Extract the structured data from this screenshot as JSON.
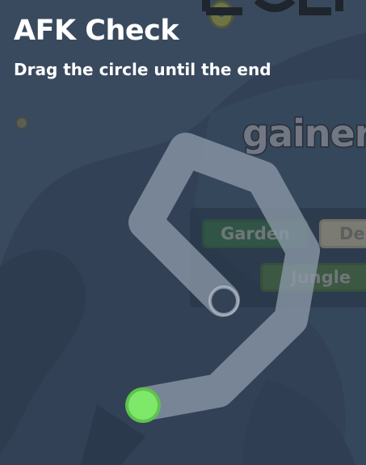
{
  "modal": {
    "title": "AFK Check",
    "subtitle": "Drag the circle until the end"
  },
  "background": {
    "gainer_text": "gainer",
    "biome_buttons": [
      {
        "label": "Garden"
      },
      {
        "label": "De"
      },
      {
        "label": "Jungle"
      }
    ]
  },
  "colors": {
    "overlay": "#3a4a5e",
    "path": "#8c98a8",
    "drag_handle": "#7ee86a",
    "drag_handle_border": "#5fc24e"
  },
  "icons": {
    "end_target": "ring-icon",
    "drag_handle": "circle-icon"
  }
}
